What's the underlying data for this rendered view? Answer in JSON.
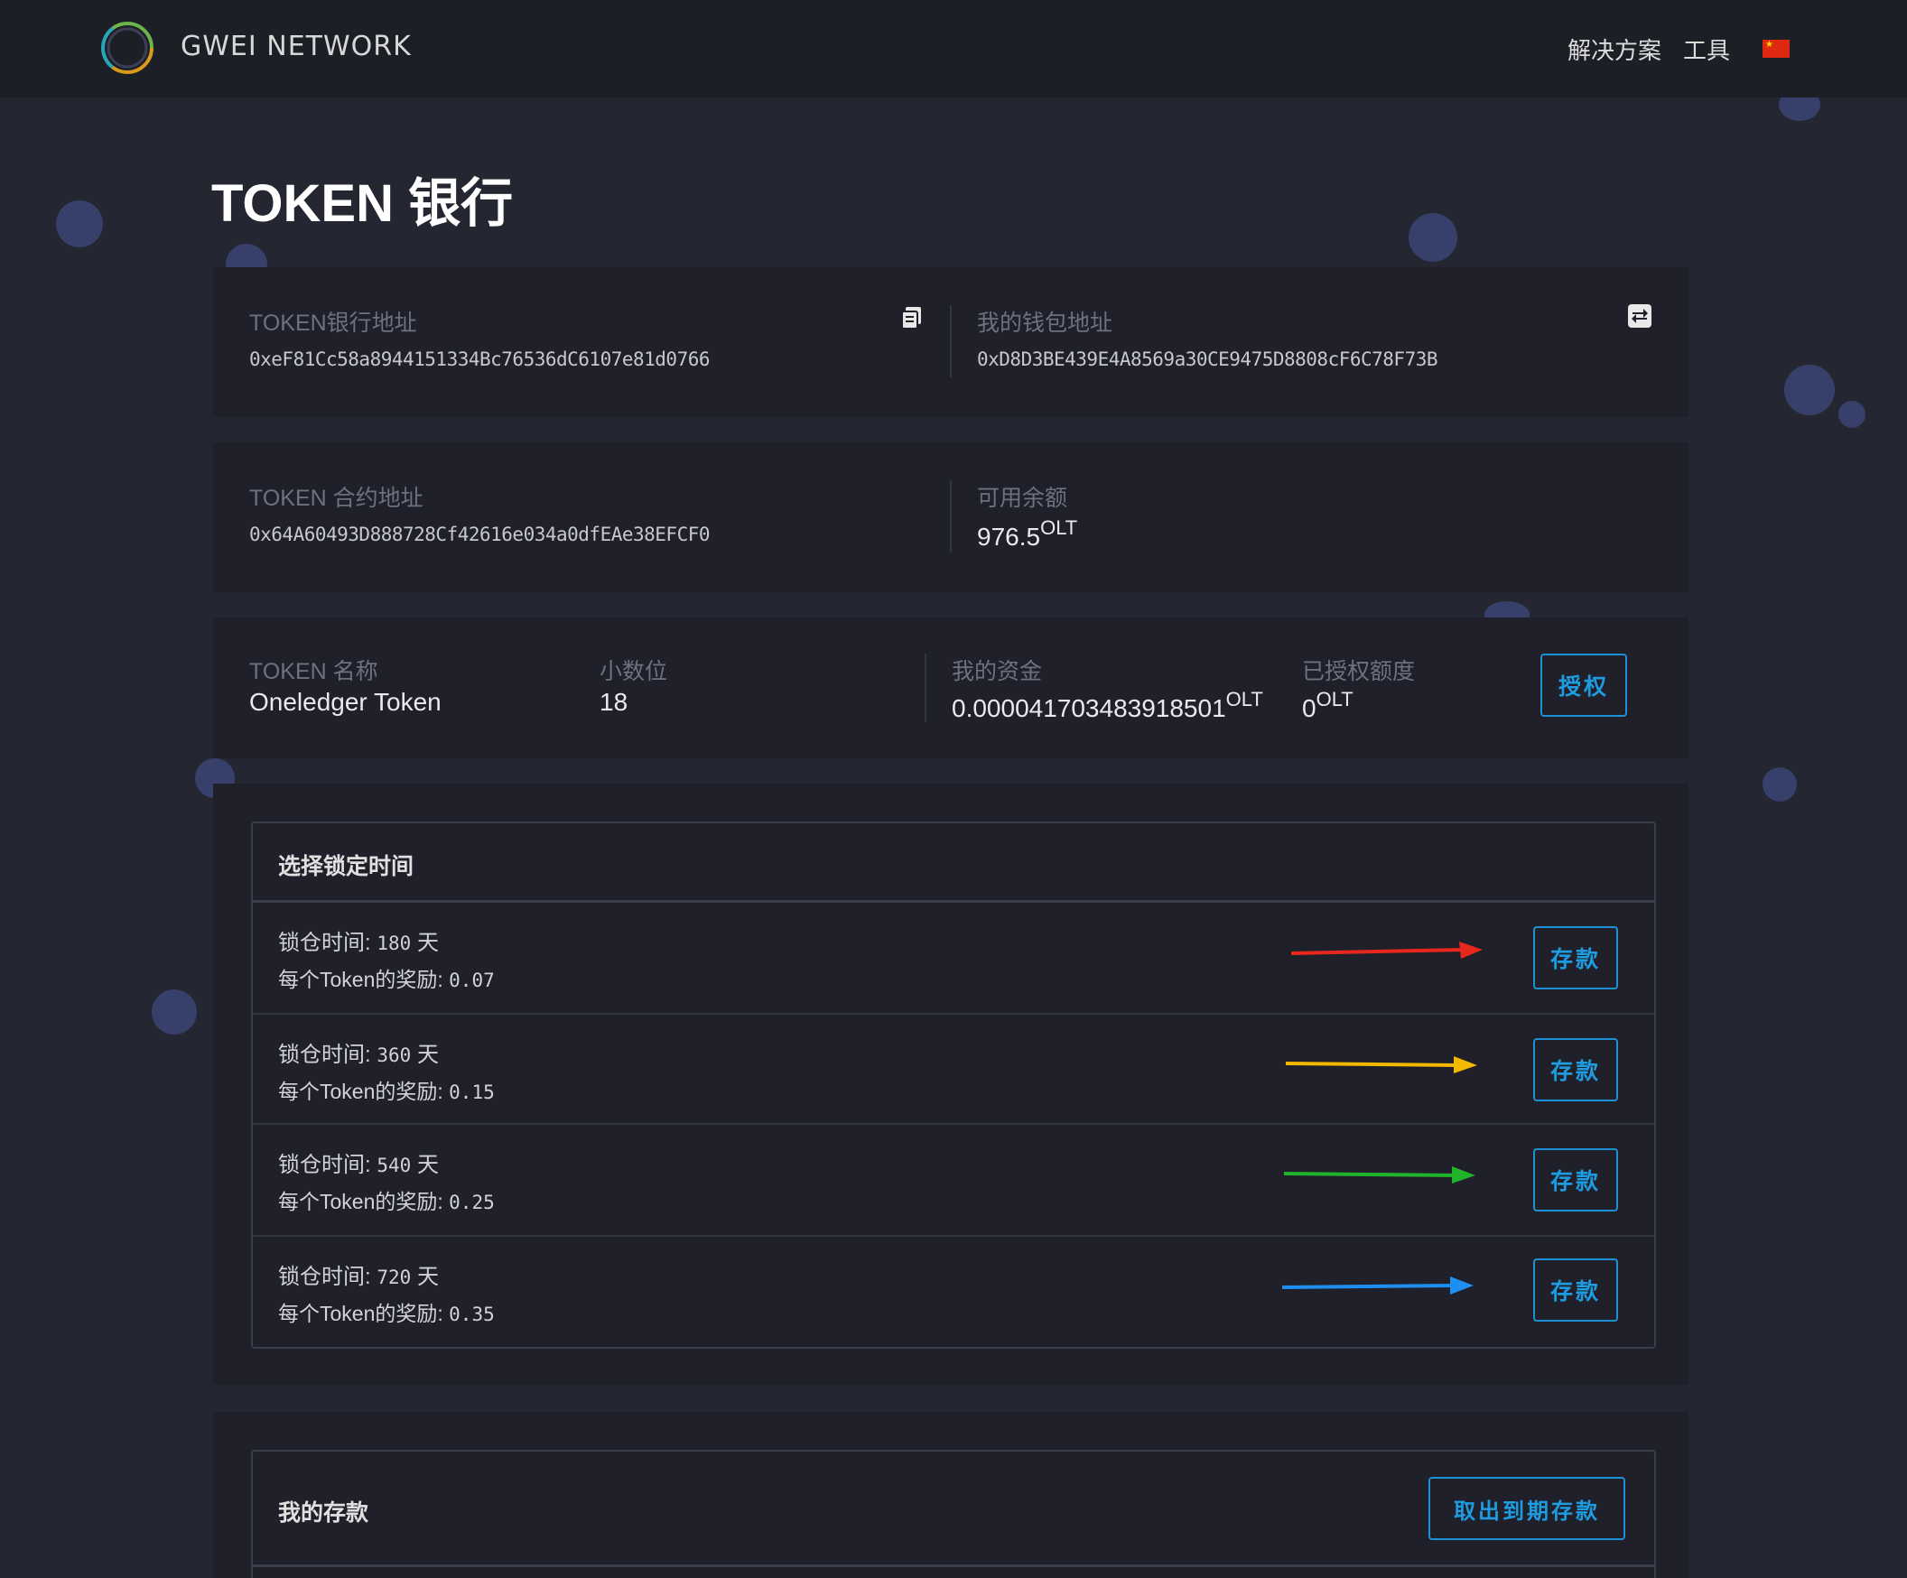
{
  "nav": {
    "brand": "GWEI NETWORK",
    "links": [
      "解决方案",
      "工具"
    ],
    "language_flag": "cn-flag-icon"
  },
  "page": {
    "title": "TOKEN 银行"
  },
  "bank_info": {
    "bank_address_label": "TOKEN银行地址",
    "bank_address": "0xeF81Cc58a8944151334Bc76536dC6107e81d0766",
    "wallet_address_label": "我的钱包地址",
    "wallet_address": "0xD8D3BE439E4A8569a30CE9475D8808cF6C78F73B",
    "contract_address_label": "TOKEN 合约地址",
    "contract_address": "0x64A60493D888728Cf42616e034a0dfEAe38EFCF0",
    "available_label": "可用余额",
    "available_value": "976.5",
    "available_unit": "OLT"
  },
  "token_info": {
    "name_label": "TOKEN 名称",
    "name_value": "Oneledger Token",
    "decimals_label": "小数位",
    "decimals_value": "18",
    "funds_label": "我的资金",
    "funds_value": "0.000041703483918501",
    "funds_unit": "OLT",
    "allowance_label": "已授权额度",
    "allowance_value": "0",
    "allowance_unit": "OLT",
    "authorize_button": "授权"
  },
  "lock_panel": {
    "title": "选择锁定时间",
    "time_prefix": "锁仓时间:",
    "reward_prefix": "每个Token的奖励:",
    "day_unit": "天",
    "deposit_button": "存款",
    "options": [
      {
        "days": "180",
        "reward": "0.07",
        "arrow_color": "#e8271e"
      },
      {
        "days": "360",
        "reward": "0.15",
        "arrow_color": "#f5b800"
      },
      {
        "days": "540",
        "reward": "0.25",
        "arrow_color": "#22b32c"
      },
      {
        "days": "720",
        "reward": "0.35",
        "arrow_color": "#1e8ff0"
      }
    ]
  },
  "deposits_panel": {
    "title": "我的存款",
    "withdraw_button": "取出到期存款"
  },
  "colors": {
    "accent": "#1f9be0",
    "background": "#242631",
    "card": "#1f2029",
    "navbar": "#1d1f27"
  }
}
